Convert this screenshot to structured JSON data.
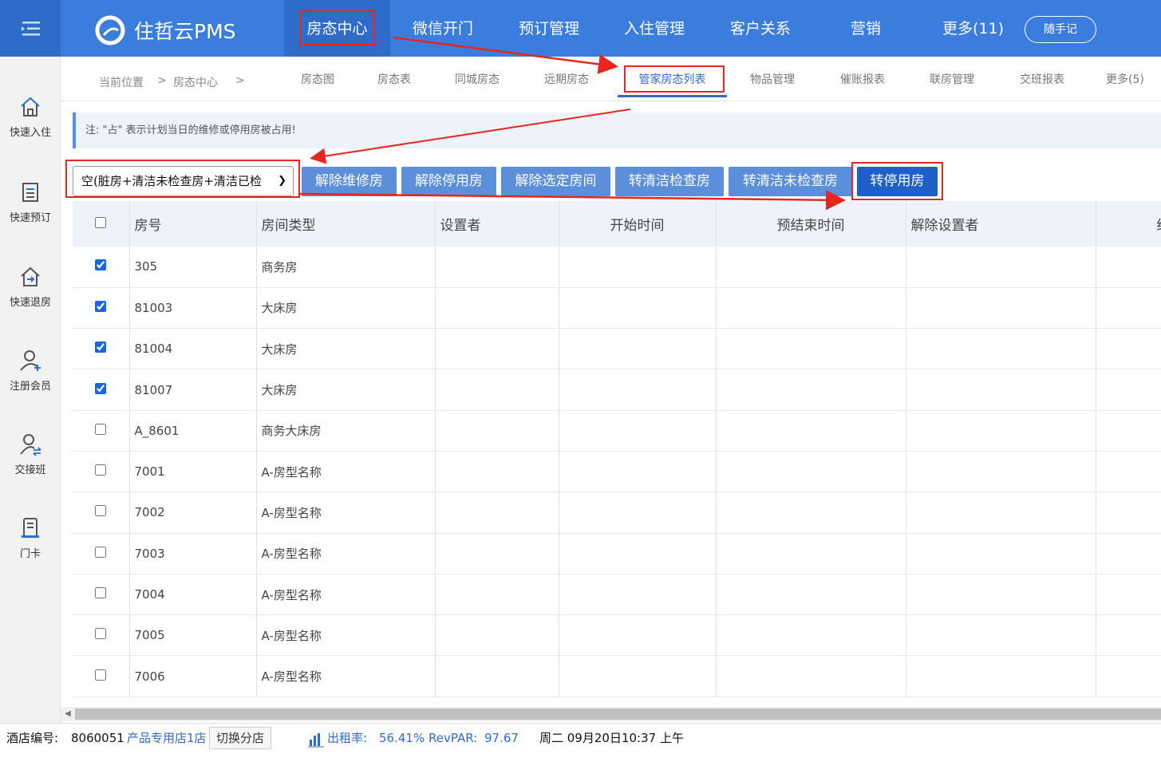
{
  "app": {
    "brand": "住哲云PMS"
  },
  "nav": {
    "items": [
      "房态中心",
      "微信开门",
      "预订管理",
      "入住管理",
      "客户关系",
      "营销",
      "更多(11)"
    ],
    "memo": "随手记"
  },
  "sidebar": {
    "items": [
      "快速入住",
      "快速预订",
      "快速退房",
      "注册会员",
      "交接班",
      "门卡"
    ]
  },
  "breadcrumb": {
    "label": "当前位置",
    "sep": ">",
    "current": "房态中心",
    "tail": ">"
  },
  "subtabs": [
    "房态图",
    "房态表",
    "同城房态",
    "远期房态",
    "管家房态列表",
    "物品管理",
    "催账报表",
    "联房管理",
    "交班报表",
    "更多(5)"
  ],
  "notice": "注: \"占\" 表示计划当日的维修或停用房被占用!",
  "filter": {
    "value": "空(脏房+清洁未检查房+清洁已检"
  },
  "actions": [
    "解除维修房",
    "解除停用房",
    "解除选定房间",
    "转清洁检查房",
    "转清洁未检查房",
    "转停用房"
  ],
  "table": {
    "headers": [
      "房号",
      "房间类型",
      "设置者",
      "开始时间",
      "预结束时间",
      "解除设置者",
      "结"
    ],
    "rows": [
      {
        "checked": true,
        "room": "305",
        "type": "商务房"
      },
      {
        "checked": true,
        "room": "81003",
        "type": "大床房"
      },
      {
        "checked": true,
        "room": "81004",
        "type": "大床房"
      },
      {
        "checked": true,
        "room": "81007",
        "type": "大床房"
      },
      {
        "checked": false,
        "room": "A_8601",
        "type": "商务大床房"
      },
      {
        "checked": false,
        "room": "7001",
        "type": "A-房型名称"
      },
      {
        "checked": false,
        "room": "7002",
        "type": "A-房型名称"
      },
      {
        "checked": false,
        "room": "7003",
        "type": "A-房型名称"
      },
      {
        "checked": false,
        "room": "7004",
        "type": "A-房型名称"
      },
      {
        "checked": false,
        "room": "7005",
        "type": "A-房型名称"
      },
      {
        "checked": false,
        "room": "7006",
        "type": "A-房型名称"
      }
    ]
  },
  "status": {
    "hotel_label": "酒店编号:",
    "hotel_id": "8060051",
    "store": "产品专用店1店",
    "switch": "切换分店",
    "occupancy_label": "出租率:",
    "occupancy": "56.41%",
    "revpar_label": "RevPAR:",
    "revpar": "97.67",
    "datetime": "周二 09月20日10:37 上午"
  },
  "colors": {
    "topbar": "#3b7ddd",
    "active": "#2f6cc9",
    "button": "#5b8fd9",
    "button_primary": "#1f5fc8",
    "highlight": "#e8261b",
    "link": "#2f6cc9"
  },
  "icons": [
    "menu-icon",
    "brand-logo-icon",
    "home-icon",
    "booking-icon",
    "checkout-icon",
    "add-member-icon",
    "shift-icon",
    "card-icon",
    "chart-icon"
  ]
}
